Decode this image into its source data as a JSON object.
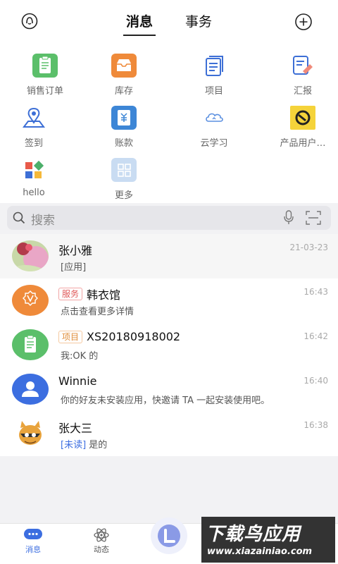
{
  "header": {
    "tabs": [
      {
        "label": "消息",
        "active": true
      },
      {
        "label": "事务",
        "active": false
      }
    ],
    "left_icon": "service-icon",
    "right_icon": "plus-circle-icon"
  },
  "apps": [
    {
      "label": "销售订单",
      "icon": "sales-order-icon",
      "color": "#5bbf6a"
    },
    {
      "label": "库存",
      "icon": "inventory-icon",
      "color": "#ef8a3a"
    },
    {
      "label": "项目",
      "icon": "project-icon",
      "color": "#3d6fd6"
    },
    {
      "label": "汇报",
      "icon": "report-icon",
      "color": "#3d6fd6"
    },
    {
      "label": "签到",
      "icon": "checkin-icon",
      "color": "#3d6fd6"
    },
    {
      "label": "账款",
      "icon": "accounts-icon",
      "color": "#3d86d6"
    },
    {
      "label": "云学习",
      "icon": "cloud-learn-icon",
      "color": "#5a8fe0"
    },
    {
      "label": "产品用户…",
      "icon": "product-user-icon",
      "color": "#f5d33a"
    },
    {
      "label": "hello",
      "icon": "hello-icon",
      "color": "#e85a4a"
    },
    {
      "label": "更多",
      "icon": "more-grid-icon",
      "color": "#c9dcf2"
    }
  ],
  "search": {
    "placeholder": "搜索"
  },
  "messages": [
    {
      "name": "张小雅",
      "preview": "[应用]",
      "time": "21-03-23"
    },
    {
      "tag": "服务",
      "name": "韩衣馆",
      "preview": "点击查看更多详情",
      "time": "16:43"
    },
    {
      "tag": "项目",
      "name": "XS20180918002",
      "preview": "我:OK 的",
      "time": "16:42"
    },
    {
      "name": "Winnie",
      "preview": "你的好友未安装应用，快邀请 TA 一起安装使用吧。",
      "time": "16:40"
    },
    {
      "name": "张大三",
      "unread": "[未读]",
      "preview": "是的",
      "time": "16:38"
    }
  ],
  "nav": [
    {
      "label": "消息",
      "icon": "chat-bubble-icon"
    },
    {
      "label": "动态",
      "icon": "atom-icon"
    }
  ],
  "watermark": {
    "line1": "下载鸟应用",
    "line2": "www.xiazainiao.com"
  },
  "colors": {
    "accent": "#3c6ee0",
    "nav_active": "#3c6ee0"
  }
}
